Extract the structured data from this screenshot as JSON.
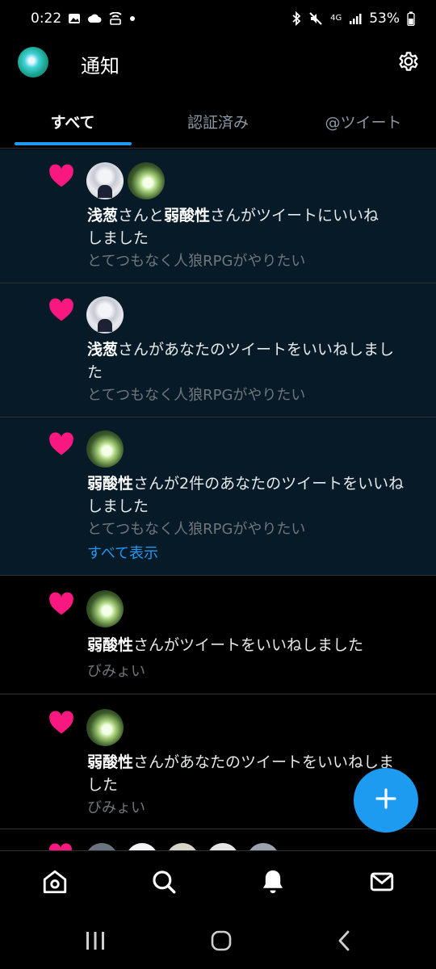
{
  "status_bar": {
    "time": "0:22",
    "network": "4G",
    "battery": "53%"
  },
  "header": {
    "title": "通知"
  },
  "tabs": [
    {
      "label": "すべて",
      "active": true
    },
    {
      "label": "認証済み",
      "active": false
    },
    {
      "label": "@ツイート",
      "active": false
    }
  ],
  "notifications": [
    {
      "actor1": "浅葱",
      "mid1": "さんと",
      "actor2": "弱酸性",
      "rest_line1": "さんがツイートにいいね",
      "rest_line2": "しました",
      "subtitle": "とてつもなく人狼RPGがやりたい"
    },
    {
      "actor1": "浅葱",
      "rest_line1": "さんがあなたのツイートをいいねしまし",
      "rest_line2": "た",
      "subtitle": "とてつもなく人狼RPGがやりたい"
    },
    {
      "actor1": "弱酸性",
      "rest_line1": "さんが2件のあなたのツイートをいいね",
      "rest_line2": "しました",
      "subtitle": "とてつもなく人狼RPGがやりたい",
      "link": "すべて表示"
    },
    {
      "actor1": "弱酸性",
      "rest_line1": "さんがツイートをいいねしました",
      "subtitle": "びみょい"
    },
    {
      "actor1": "弱酸性",
      "rest_line1": "さんがあなたのツイートをいいねしま",
      "rest_line2": "した",
      "subtitle": "びみょい"
    }
  ],
  "icons": {
    "heart": "heart-icon",
    "settings": "gear-icon",
    "compose": "plus-icon",
    "nav": [
      "home-icon",
      "search-icon",
      "bell-icon",
      "mail-icon"
    ],
    "system": [
      "recents-icon",
      "home-circle-icon",
      "back-chevron-icon"
    ]
  },
  "colors": {
    "accent": "#1d9bf0",
    "heart": "#f91880",
    "unread_bg": "#071a27"
  }
}
